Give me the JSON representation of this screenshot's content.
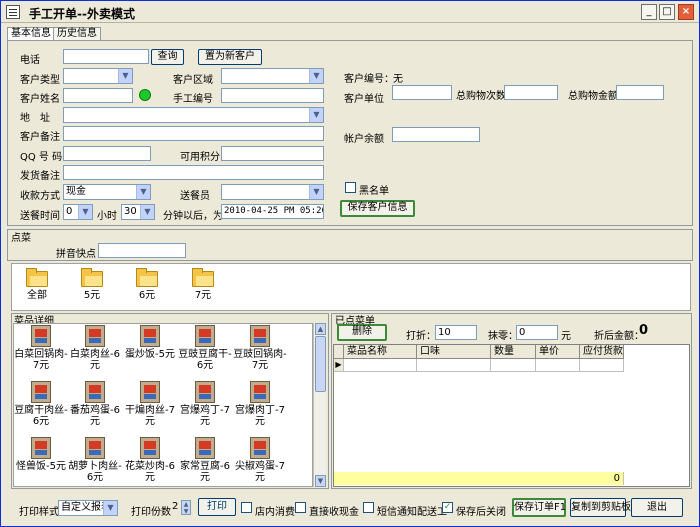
{
  "window": {
    "title": "手工开单--外卖模式"
  },
  "tabs": [
    "基本信息",
    "历史信息"
  ],
  "customer": {
    "phone_label": "电话",
    "phone_value": "",
    "search_btn": "查询",
    "reset_btn": "置为新客户",
    "type_label": "客户类型",
    "area_label": "客户区域",
    "name_label": "客户姓名",
    "manual_no_label": "手工编号",
    "address_label": "地　址",
    "note_label": "客户备注",
    "qq_label": "QQ 号 码",
    "points_label": "可用积分",
    "ship_note_label": "发货备注",
    "pay_label": "收款方式",
    "pay_value": "现金",
    "courier_label": "送餐员",
    "delivery_label": "送餐时间",
    "delivery_hour": "0",
    "hour_label": "小时",
    "delivery_min": "30",
    "min_label": "分钟以后，为",
    "delivery_datetime": "2010-04-25 PM 05:26:02",
    "code_label": "客户编号：",
    "code_value": "无",
    "unit_label": "客户单位",
    "total_times_label": "总购物次数",
    "total_amount_label": "总购物金额",
    "balance_label": "帐户余额",
    "blacklist_label": "黑名单",
    "save_customer_btn": "保存客户信息"
  },
  "order_section": {
    "title": "点菜",
    "pinyin_label": "拼音快点"
  },
  "categories": [
    "全部",
    "5元",
    "6元",
    "7元"
  ],
  "dishes_section": {
    "title": "菜品详细"
  },
  "dishes": [
    "白菜回锅肉-7元",
    "白菜肉丝-6元",
    "蛋炒饭-5元",
    "豆豉豆腐干-6元",
    "豆豉回锅肉-7元",
    "豆腐干肉丝-6元",
    "番茄鸡蛋-6元",
    "干煸肉丝-7元",
    "宫爆鸡丁-7元",
    "宫爆肉丁-7元",
    "怪兽饭-5元",
    "胡萝卜肉丝-6元",
    "花菜炒肉-6元",
    "家常豆腐-6元",
    "尖椒鸡蛋-7元"
  ],
  "ordered": {
    "title": "已点菜单",
    "delete_btn": "删除",
    "discount_label": "打折：",
    "discount_value": "10",
    "round_label": "抹零：",
    "round_value": "0",
    "yuan": "元",
    "after_label": "折后金额：",
    "after_value": "0",
    "columns": [
      "菜品名称",
      "口味",
      "数量",
      "单价",
      "应付货款"
    ],
    "footer_total": "0"
  },
  "bottom": {
    "print_style_label": "打印样式",
    "print_style_value": "自定义报表",
    "copies_label": "打印份数",
    "copies_value": "2",
    "print_btn": "打印",
    "dine_in_label": "店内消费",
    "cash_label": "直接收现金",
    "sms_label": "短信通知配送工",
    "close_after_label": "保存后关闭",
    "save_order_btn": "保存订单F1",
    "copy_btn": "复制到剪贴板",
    "exit_btn": "退出"
  }
}
